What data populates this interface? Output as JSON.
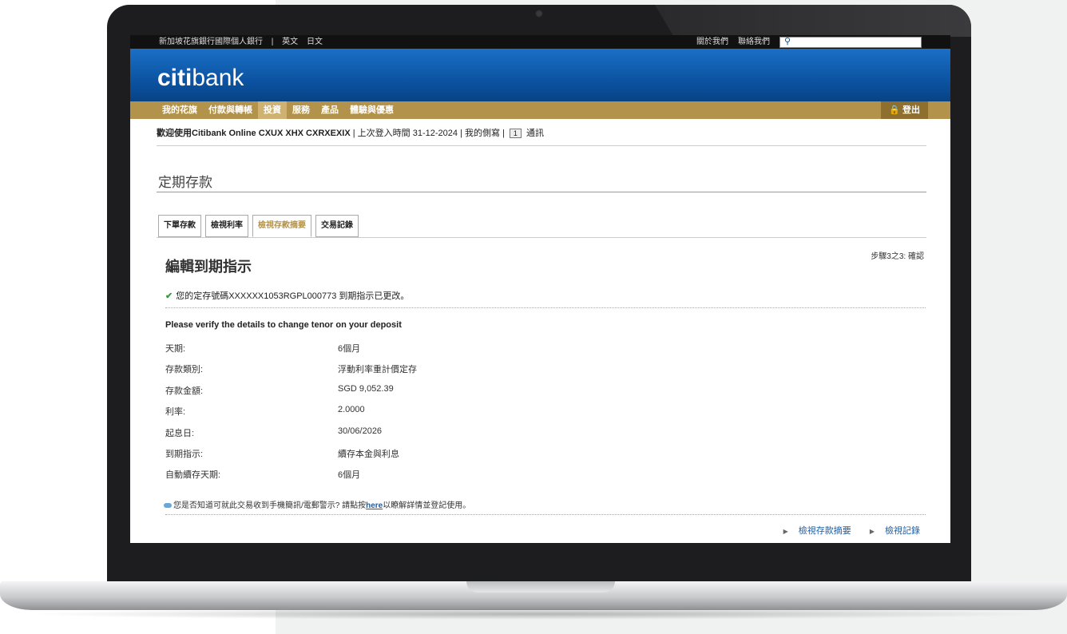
{
  "topbar": {
    "left": [
      "新加坡花旗銀行國際個人銀行",
      "|",
      "英文",
      "日文"
    ],
    "about": "關於我們",
    "contact": "聯絡我們"
  },
  "logo": {
    "citi": "citi",
    "bank": "bank"
  },
  "nav": {
    "items": [
      "我的花旗",
      "付款與轉帳",
      "投資",
      "服務",
      "產品",
      "體驗與優惠"
    ],
    "logout": "🔒 登出"
  },
  "welcome": {
    "prefix": "歡迎使用Citibank Online",
    "name": "CXUX XHX CXRXEXIX",
    "last_login": "| 上次登入時間 31-12-2024 | 我的側寫 |",
    "msg_count": "1",
    "msg_label": "通訊"
  },
  "page_title": "定期存款",
  "tabs": [
    "下單存款",
    "檢視利率",
    "檢視存款摘要",
    "交易記錄"
  ],
  "step": "步驟3之3: 確認",
  "heading": "編輯到期指示",
  "success_msg": "您的定存號碼XXXXXX1053RGPL000773 到期指示已更改。",
  "verify_title": "Please verify the details to change tenor on your deposit",
  "details": [
    {
      "label": "天期:",
      "value": "6個月"
    },
    {
      "label": "存款類別:",
      "value": "浮動利率重計價定存"
    },
    {
      "label": "存款金額:",
      "value": "SGD 9,052.39"
    },
    {
      "label": "利率:",
      "value": "2.0000"
    },
    {
      "label": "起息日:",
      "value": "30/06/2026"
    },
    {
      "label": "到期指示:",
      "value": "續存本金與利息"
    },
    {
      "label": "自動續存天期:",
      "value": "6個月"
    }
  ],
  "tip": {
    "before": "您是否知道可就此交易收到手機簡訊/電郵警示? 請點按",
    "link": "here",
    "after": "以瞭解詳情並登記使用。"
  },
  "bottom_links": [
    "檢視存款摘要",
    "檢視記錄"
  ]
}
